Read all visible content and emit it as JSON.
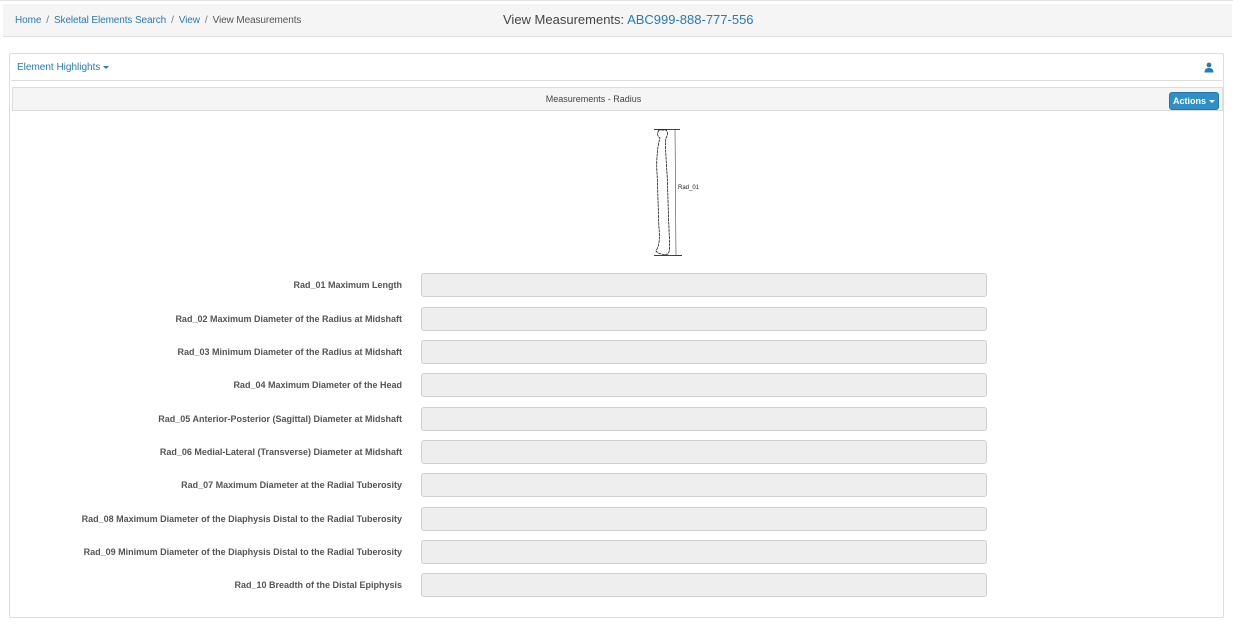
{
  "breadcrumb": {
    "items": [
      {
        "label": "Home"
      },
      {
        "label": "Skeletal Elements Search"
      },
      {
        "label": "View"
      }
    ],
    "current": "View Measurements",
    "separator": "/"
  },
  "header": {
    "title_prefix": "View Measurements:",
    "record_id": "ABC999-888-777-556"
  },
  "highlights": {
    "label": "Element Highlights"
  },
  "panel": {
    "title": "Measurements - Radius",
    "actions_label": "Actions"
  },
  "figure": {
    "label": "Rad_01"
  },
  "measurements": [
    {
      "label": "Rad_01 Maximum Length",
      "value": ""
    },
    {
      "label": "Rad_02 Maximum Diameter of the Radius at Midshaft",
      "value": ""
    },
    {
      "label": "Rad_03 Minimum Diameter of the Radius at Midshaft",
      "value": ""
    },
    {
      "label": "Rad_04 Maximum Diameter of the Head",
      "value": ""
    },
    {
      "label": "Rad_05 Anterior-Posterior (Sagittal) Diameter at Midshaft",
      "value": ""
    },
    {
      "label": "Rad_06 Medial-Lateral (Transverse) Diameter at Midshaft",
      "value": ""
    },
    {
      "label": "Rad_07 Maximum Diameter at the Radial Tuberosity",
      "value": ""
    },
    {
      "label": "Rad_08 Maximum Diameter of the Diaphysis Distal to the Radial Tuberosity",
      "value": ""
    },
    {
      "label": "Rad_09 Minimum Diameter of the Diaphysis Distal to the Radial Tuberosity",
      "value": ""
    },
    {
      "label": "Rad_10 Breadth of the Distal Epiphysis",
      "value": ""
    }
  ],
  "colors": {
    "link": "#2a7ab8",
    "primary_button": "#2f8fcb",
    "input_readonly_bg": "#eeeeee"
  },
  "icons": {
    "user": "user-icon",
    "dropdown": "caret-down-icon"
  }
}
